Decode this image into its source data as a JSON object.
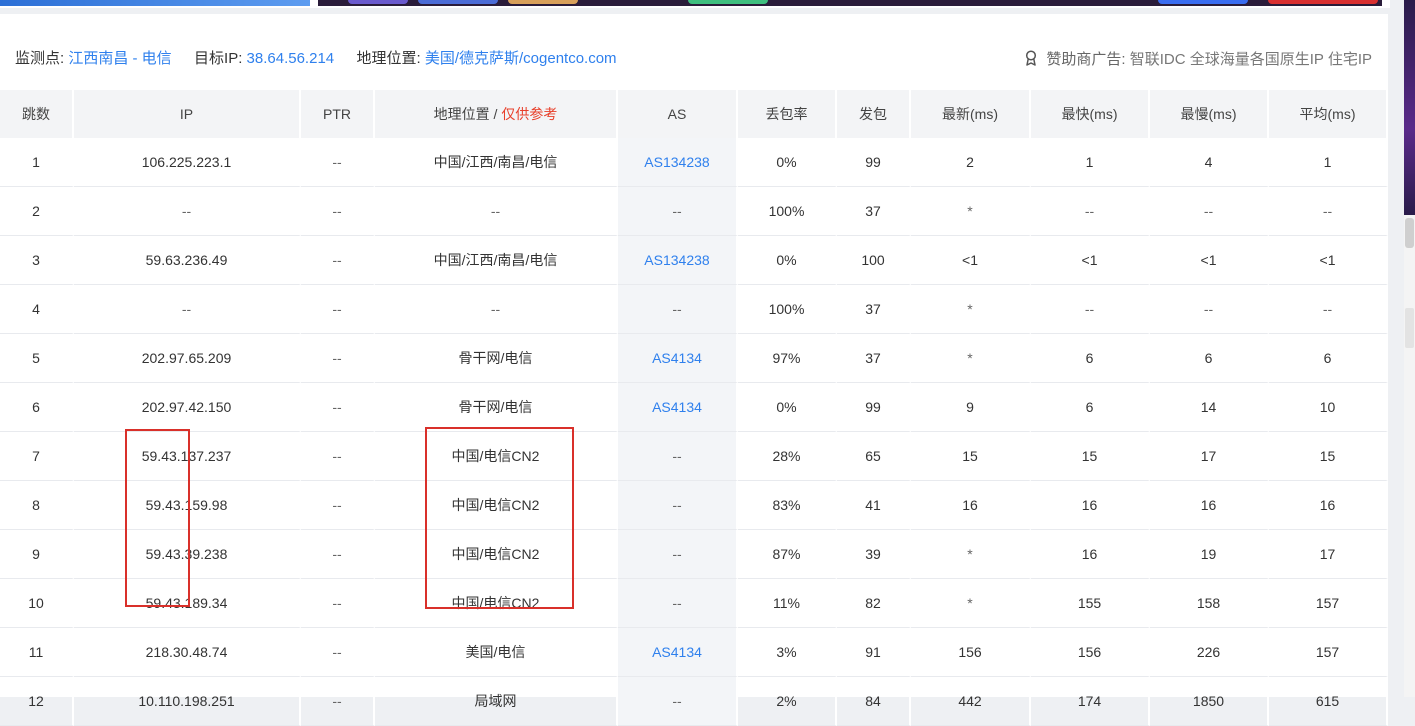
{
  "info": {
    "monitor_label": "监测点:",
    "monitor_value": "江西南昌 - 电信",
    "target_label": "目标IP:",
    "target_value": "38.64.56.214",
    "geo_label": "地理位置:",
    "geo_value": "美国/德克萨斯/cogentco.com",
    "sponsor_label": "赞助商广告:",
    "sponsor_text": "智联IDC 全球海量各国原生IP 住宅IP"
  },
  "table": {
    "headers": {
      "hop": "跳数",
      "ip": "IP",
      "ptr": "PTR",
      "geo": "地理位置 / ",
      "geo_ref": "仅供参考",
      "as": "AS",
      "loss": "丢包率",
      "sent": "发包",
      "latest": "最新(ms)",
      "fastest": "最快(ms)",
      "slowest": "最慢(ms)",
      "avg": "平均(ms)"
    },
    "rows": [
      {
        "hop": "1",
        "ip": "106.225.223.1",
        "ptr": "--",
        "geo": "中国/江西/南昌/电信",
        "as": "AS134238",
        "loss": "0%",
        "sent": "99",
        "latest": "2",
        "fastest": "1",
        "slowest": "4",
        "avg": "1"
      },
      {
        "hop": "2",
        "ip": "--",
        "ptr": "--",
        "geo": "--",
        "as": "--",
        "loss": "100%",
        "sent": "37",
        "latest": "*",
        "fastest": "--",
        "slowest": "--",
        "avg": "--"
      },
      {
        "hop": "3",
        "ip": "59.63.236.49",
        "ptr": "--",
        "geo": "中国/江西/南昌/电信",
        "as": "AS134238",
        "loss": "0%",
        "sent": "100",
        "latest": "<1",
        "fastest": "<1",
        "slowest": "<1",
        "avg": "<1"
      },
      {
        "hop": "4",
        "ip": "--",
        "ptr": "--",
        "geo": "--",
        "as": "--",
        "loss": "100%",
        "sent": "37",
        "latest": "*",
        "fastest": "--",
        "slowest": "--",
        "avg": "--"
      },
      {
        "hop": "5",
        "ip": "202.97.65.209",
        "ptr": "--",
        "geo": "骨干网/电信",
        "as": "AS4134",
        "loss": "97%",
        "sent": "37",
        "latest": "*",
        "fastest": "6",
        "slowest": "6",
        "avg": "6"
      },
      {
        "hop": "6",
        "ip": "202.97.42.150",
        "ptr": "--",
        "geo": "骨干网/电信",
        "as": "AS4134",
        "loss": "0%",
        "sent": "99",
        "latest": "9",
        "fastest": "6",
        "slowest": "14",
        "avg": "10"
      },
      {
        "hop": "7",
        "ip": "59.43.137.237",
        "ptr": "--",
        "geo": "中国/电信CN2",
        "as": "--",
        "loss": "28%",
        "sent": "65",
        "latest": "15",
        "fastest": "15",
        "slowest": "17",
        "avg": "15"
      },
      {
        "hop": "8",
        "ip": "59.43.159.98",
        "ptr": "--",
        "geo": "中国/电信CN2",
        "as": "--",
        "loss": "83%",
        "sent": "41",
        "latest": "16",
        "fastest": "16",
        "slowest": "16",
        "avg": "16"
      },
      {
        "hop": "9",
        "ip": "59.43.39.238",
        "ptr": "--",
        "geo": "中国/电信CN2",
        "as": "--",
        "loss": "87%",
        "sent": "39",
        "latest": "*",
        "fastest": "16",
        "slowest": "19",
        "avg": "17"
      },
      {
        "hop": "10",
        "ip": "59.43.189.34",
        "ptr": "--",
        "geo": "中国/电信CN2",
        "as": "--",
        "loss": "11%",
        "sent": "82",
        "latest": "*",
        "fastest": "155",
        "slowest": "158",
        "avg": "157"
      },
      {
        "hop": "11",
        "ip": "218.30.48.74",
        "ptr": "--",
        "geo": "美国/电信",
        "as": "AS4134",
        "loss": "3%",
        "sent": "91",
        "latest": "156",
        "fastest": "156",
        "slowest": "226",
        "avg": "157"
      },
      {
        "hop": "12",
        "ip": "10.110.198.251",
        "ptr": "--",
        "geo": "局域网",
        "as": "--",
        "loss": "2%",
        "sent": "84",
        "latest": "442",
        "fastest": "174",
        "slowest": "1850",
        "avg": "615"
      }
    ]
  },
  "icons": {
    "sponsor": "award-ribbon-icon"
  },
  "colors": {
    "link": "#2f80ed",
    "reference_note": "#e8402b",
    "highlight_box": "#d9302a",
    "header_bg": "#f3f4f6"
  }
}
